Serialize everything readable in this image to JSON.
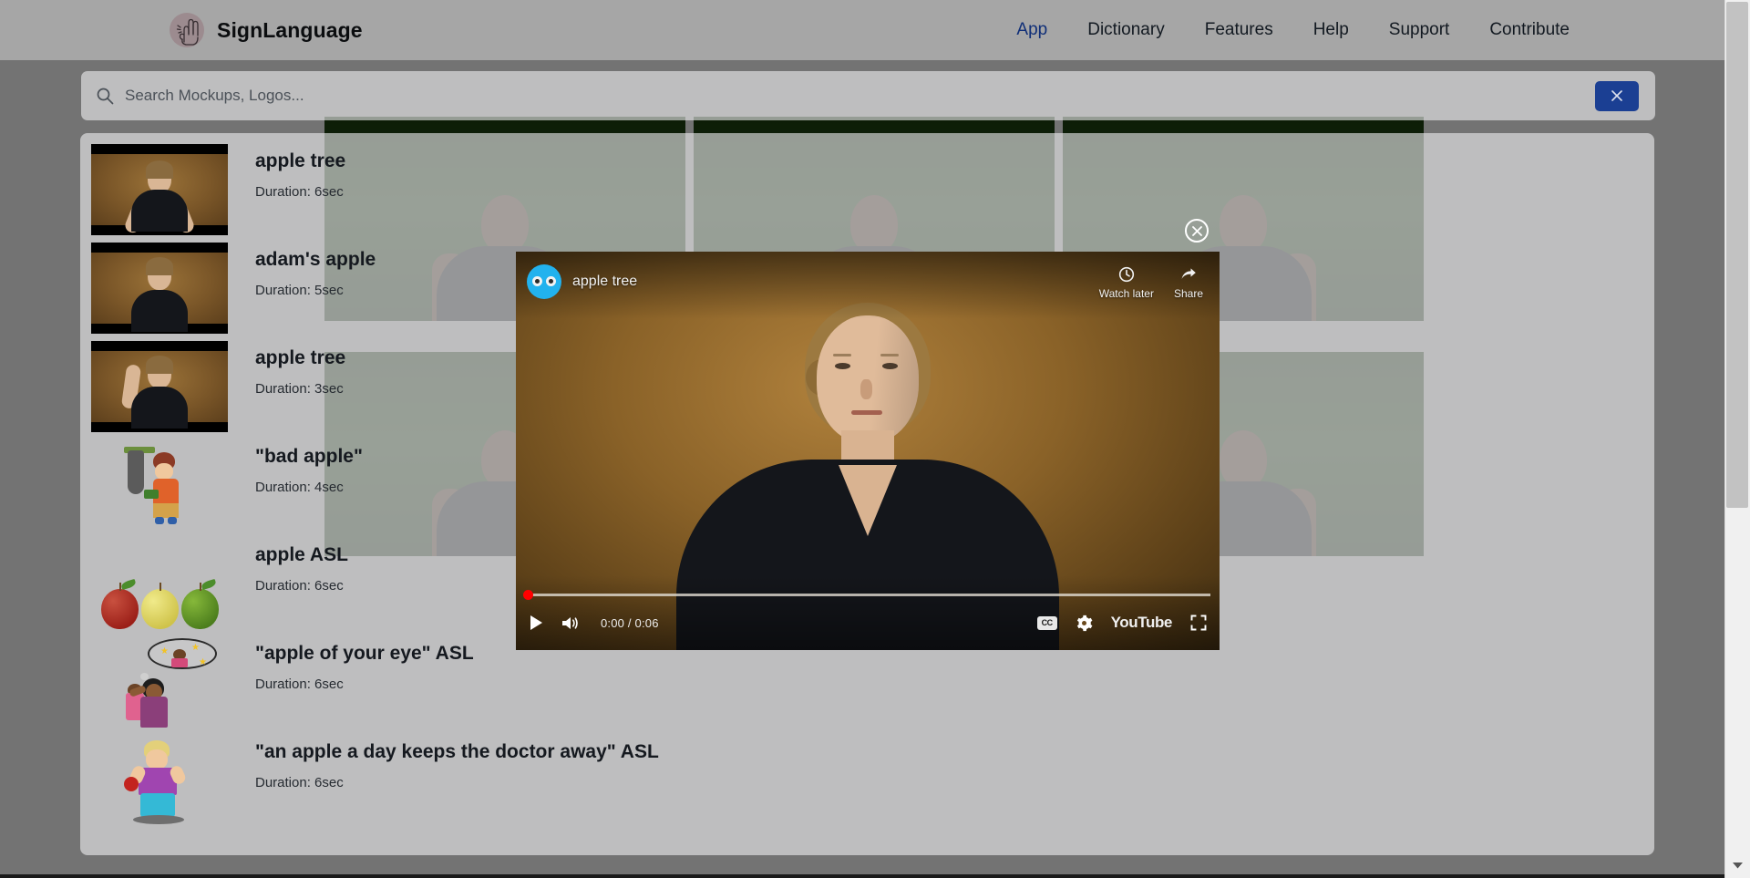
{
  "nav": {
    "brand": "SignLanguage",
    "logo_icon": "hand-sign-icon",
    "links": [
      {
        "label": "App",
        "active": true
      },
      {
        "label": "Dictionary",
        "active": false
      },
      {
        "label": "Features",
        "active": false
      },
      {
        "label": "Help",
        "active": false
      },
      {
        "label": "Support",
        "active": false
      },
      {
        "label": "Contribute",
        "active": false
      }
    ],
    "active_color": "#1a49b8"
  },
  "search": {
    "placeholder": "Search Mockups, Logos...",
    "value": "",
    "icon": "search-icon",
    "close_button_icon": "close-icon",
    "close_button_color": "#1b3f93"
  },
  "results": {
    "items": [
      {
        "title": "apple tree",
        "duration": "Duration: 6sec",
        "thumb_type": "video"
      },
      {
        "title": "adam's apple",
        "duration": "Duration: 5sec",
        "thumb_type": "video"
      },
      {
        "title": "apple tree",
        "duration": "Duration: 3sec",
        "thumb_type": "video"
      },
      {
        "title": "\"bad apple\"",
        "duration": "Duration: 4sec",
        "thumb_type": "clipart-bad-apple"
      },
      {
        "title": "apple ASL",
        "duration": "Duration: 6sec",
        "thumb_type": "clipart-apples"
      },
      {
        "title": "\"apple of your eye\" ASL",
        "duration": "Duration: 6sec",
        "thumb_type": "clipart-apple-of-your-eye"
      },
      {
        "title": "\"an apple a day keeps the doctor away\" ASL",
        "duration": "Duration: 6sec",
        "thumb_type": "clipart-apple-a-day"
      }
    ]
  },
  "player": {
    "title": "apple tree",
    "watch_later_label": "Watch later",
    "watch_later_icon": "clock-icon",
    "share_label": "Share",
    "share_icon": "share-arrow-icon",
    "play_icon": "play-icon",
    "volume_icon": "volume-icon",
    "time": "0:00 / 0:06",
    "current_time": "0:00",
    "total_time": "0:06",
    "cc_label": "CC",
    "settings_icon": "gear-icon",
    "youtube_label": "YouTube",
    "fullscreen_icon": "fullscreen-icon",
    "progress_percent": 0,
    "close_icon": "close-circle-icon",
    "avatar_icon": "channel-avatar-icon"
  },
  "background": {
    "thumbnail_count": 6
  },
  "scrollbar": {
    "down_arrow_icon": "chevron-down-icon"
  }
}
